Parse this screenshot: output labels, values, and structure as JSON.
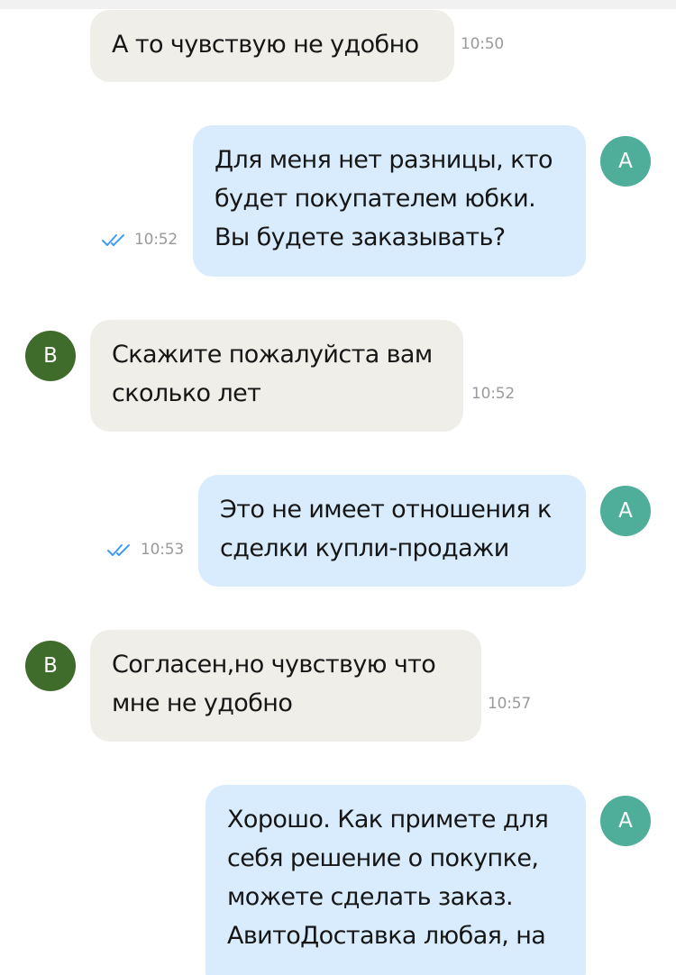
{
  "colors": {
    "incoming_bubble": "#efeee9",
    "outgoing_bubble": "#d9ecfd",
    "avatar_a": "#4fae9a",
    "avatar_b": "#3f6b2b",
    "read_check": "#3e9cf5",
    "time_text": "#9a9a9a"
  },
  "icons": {
    "read_status": "double-check-icon"
  },
  "messages": [
    {
      "direction": "incoming",
      "lines": [
        "А то чувствую не удобно"
      ],
      "time": "10:50"
    },
    {
      "direction": "outgoing",
      "avatar": "А",
      "lines": [
        "Для меня нет разницы, кто",
        "будет покупателем юбки.",
        "Вы будете заказывать?"
      ],
      "time": "10:52",
      "read": true
    },
    {
      "direction": "incoming",
      "avatar": "В",
      "lines": [
        "Скажите пожалуйста вам",
        "сколько лет"
      ],
      "time": "10:52"
    },
    {
      "direction": "outgoing",
      "avatar": "А",
      "lines": [
        "Это не имеет отношения к",
        "сделки купли-продажи"
      ],
      "time": "10:53",
      "read": true
    },
    {
      "direction": "incoming",
      "avatar": "В",
      "lines": [
        "Согласен,но чувствую что",
        "мне не удобно"
      ],
      "time": "10:57"
    },
    {
      "direction": "outgoing",
      "avatar": "А",
      "lines": [
        "Хорошо. Как примете для",
        "себя решение о покупке,",
        "можете сделать заказ.",
        "АвитоДоставка любая, на"
      ]
    }
  ]
}
